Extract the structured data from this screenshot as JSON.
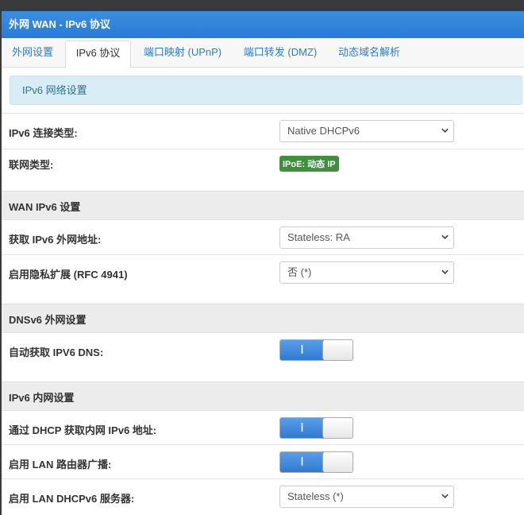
{
  "window": {
    "title": "外网 WAN - IPv6 协议"
  },
  "tabs": [
    {
      "label": "外网设置"
    },
    {
      "label": "IPv6 协议"
    },
    {
      "label": "端口映射 (UPnP)"
    },
    {
      "label": "端口转发 (DMZ)"
    },
    {
      "label": "动态域名解析"
    }
  ],
  "info_box": {
    "text": "IPv6 网络设置"
  },
  "fields": {
    "connection_type": {
      "label": "IPv6 连接类型:",
      "value": "Native DHCPv6"
    },
    "network_type": {
      "label": "联网类型:",
      "badge": "IPoE: 动态 IP"
    }
  },
  "sections": {
    "wan": {
      "title": "WAN IPv6 设置"
    },
    "dns": {
      "title": "DNSv6 外网设置"
    },
    "lan": {
      "title": "IPv6 内网设置"
    }
  },
  "wan": {
    "get_address": {
      "label": "获取 IPv6 外网地址:",
      "value": "Stateless: RA"
    },
    "privacy_ext": {
      "label": "启用隐私扩展 (RFC 4941)",
      "value": "否 (*)"
    }
  },
  "dns": {
    "auto_dns": {
      "label": "自动获取 IPV6 DNS:",
      "toggle_text": "I"
    }
  },
  "lan": {
    "dhcp_lan": {
      "label": "通过 DHCP 获取内网 IPv6 地址:",
      "toggle_text": "I"
    },
    "router_adv": {
      "label": "启用 LAN 路由器广播:",
      "toggle_text": "I"
    },
    "dhcpv6_server": {
      "label": "启用 LAN DHCPv6 服务器:",
      "value": "Stateless (*)"
    }
  },
  "colors": {
    "accent": "#2a7bd4",
    "badge": "#3f8f3f",
    "toggle_on": "#3a86da"
  }
}
